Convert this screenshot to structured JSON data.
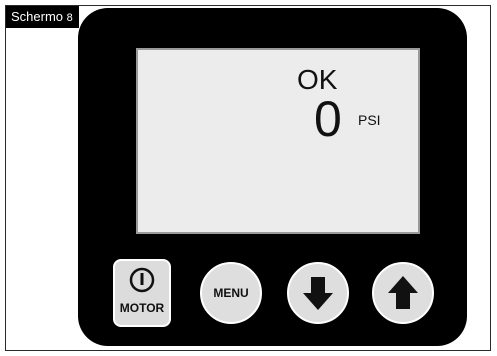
{
  "caption": {
    "label": "Schermo",
    "number": "8"
  },
  "display": {
    "status": "OK",
    "value": "0",
    "unit": "PSI"
  },
  "buttons": {
    "motor_label": "MOTOR",
    "menu_label": "MENU",
    "down_icon": "arrow-down-icon",
    "up_icon": "arrow-up-icon",
    "power_icon": "power-icon"
  },
  "colors": {
    "device_body": "#000000",
    "lcd_background": "#ececec",
    "button_face": "#dcdcdc"
  }
}
